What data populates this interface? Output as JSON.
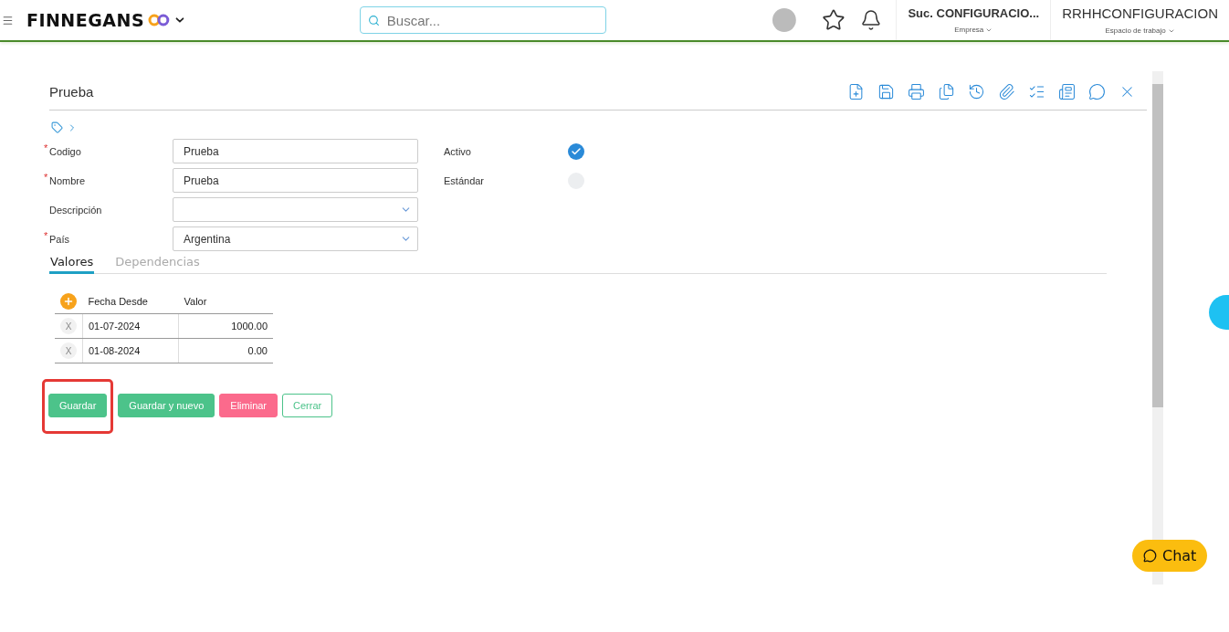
{
  "header": {
    "brand": "FINNEGANS",
    "search": {
      "placeholder": "Buscar..."
    },
    "company": {
      "value": "Suc. CONFIGURACIO...",
      "label": "Empresa"
    },
    "workspace": {
      "value": "RRHHCONFIGURACION",
      "label": "Espacio de trabajo"
    }
  },
  "form": {
    "title": "Prueba",
    "fields": [
      {
        "label": "Codigo",
        "required_mark": "*",
        "kind": "text",
        "value": "Prueba"
      },
      {
        "label": "Nombre",
        "required_mark": "*",
        "kind": "text",
        "value": "Prueba"
      },
      {
        "label": "Descripción",
        "kind": "select"
      },
      {
        "label": "País",
        "required_mark": "*",
        "kind": "select",
        "value": "Argentina"
      }
    ],
    "checks": [
      {
        "label": "Activo",
        "checked": true
      },
      {
        "label": "Estándar",
        "checked": false
      }
    ],
    "tabs": [
      {
        "label": "Valores",
        "selected": true
      },
      {
        "label": "Dependencias",
        "selected": false
      }
    ],
    "table": {
      "columns": [
        "Fecha Desde",
        "Valor"
      ],
      "rows": [
        {
          "cells": [
            "01-07-2024",
            "1000.00"
          ],
          "delete": "X"
        },
        {
          "cells": [
            "01-08-2024",
            "0.00"
          ],
          "delete": "X"
        }
      ]
    },
    "buttons": [
      {
        "label": "Guardar",
        "kind": "primary",
        "highlighted": true
      },
      {
        "label": "Guardar y nuevo",
        "kind": "primary",
        "highlighted": false
      },
      {
        "label": "Eliminar",
        "kind": "danger",
        "highlighted": false
      },
      {
        "label": "Cerrar",
        "kind": "outline",
        "highlighted": false
      }
    ]
  },
  "chat": {
    "label": "Chat"
  }
}
